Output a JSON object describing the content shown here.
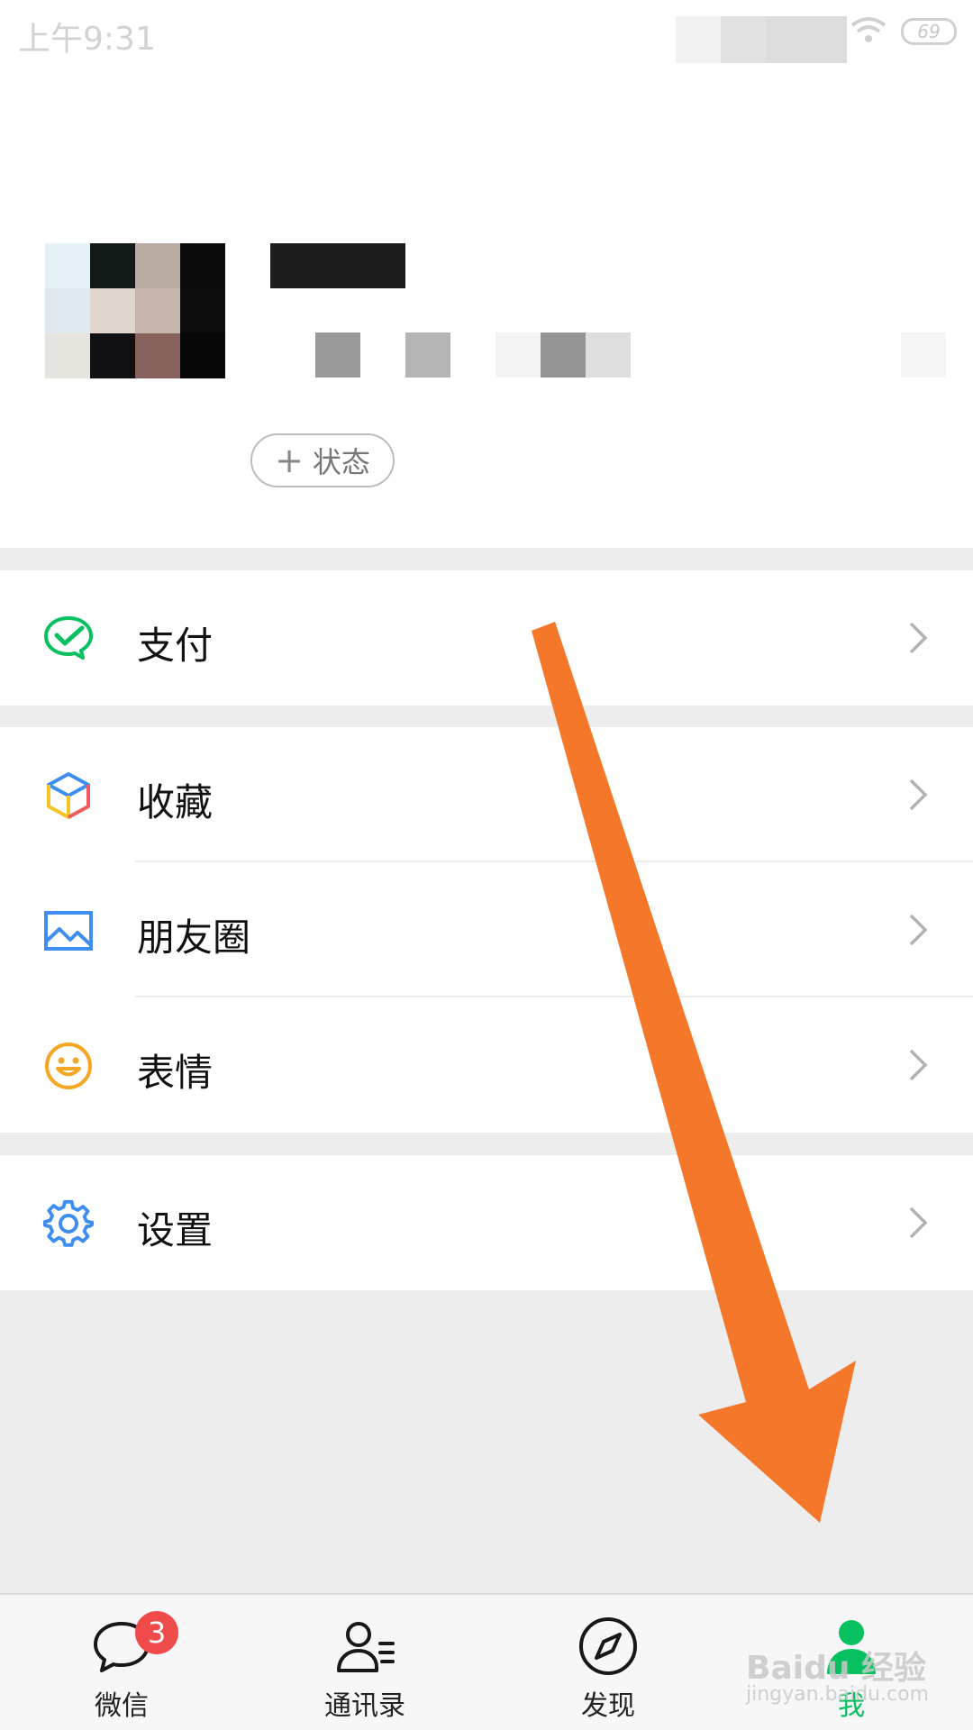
{
  "status_bar": {
    "time": "上午9:31",
    "battery": "69"
  },
  "profile": {
    "status_button_plus": "+",
    "status_button_label": "状态"
  },
  "menu": {
    "pay": "支付",
    "favorites": "收藏",
    "moments": "朋友圈",
    "stickers": "表情",
    "settings": "设置"
  },
  "tabs": {
    "chats": "微信",
    "chats_badge": "3",
    "contacts": "通讯录",
    "discover": "发现",
    "me": "我"
  },
  "watermark": {
    "brand": "Baidu 经验",
    "url": "jingyan.baidu.com"
  },
  "colors": {
    "accent_green": "#07c160",
    "arrow_orange": "#f5782a",
    "badge_red": "#f04b4b"
  }
}
